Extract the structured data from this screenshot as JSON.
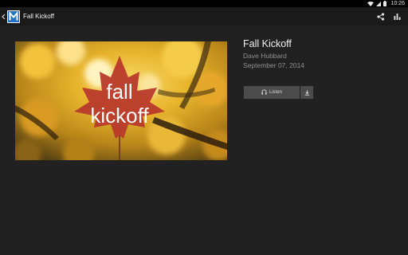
{
  "status_bar": {
    "time": "10:26"
  },
  "action_bar": {
    "title": "Fall Kickoff",
    "icons": [
      "up-chevron-icon",
      "app-logo",
      "share-icon",
      "stats-icon"
    ]
  },
  "sermon": {
    "title": "Fall Kickoff",
    "author": "Dave Hubbard",
    "date": "September 07, 2014",
    "artwork_text_line1": "fall",
    "artwork_text_line2": "kickoff"
  },
  "actions": {
    "listen_label": "Listen",
    "listen_icon": "headphones-icon",
    "download_icon": "download-icon"
  },
  "colors": {
    "background": "#212121",
    "action_bar": "#1a1a1a",
    "button": "#4b4b4b",
    "leaf": "#b83a2c",
    "logo_blue": "#1f72c4"
  }
}
